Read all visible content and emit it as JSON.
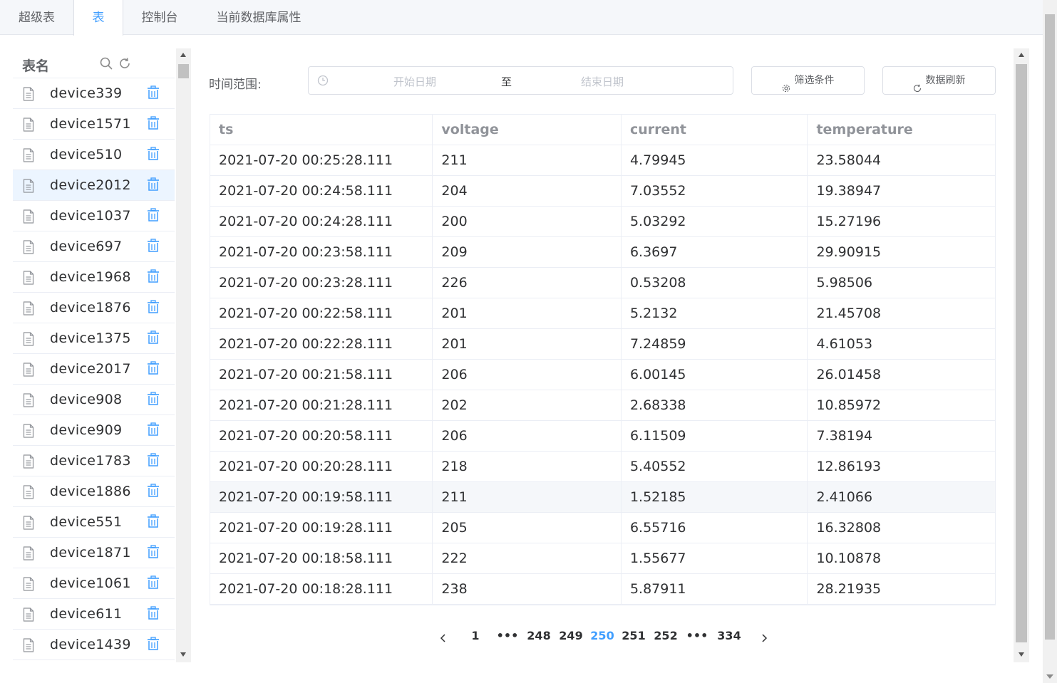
{
  "tabs": [
    {
      "label": "超级表"
    },
    {
      "label": "表"
    },
    {
      "label": "控制台"
    },
    {
      "label": "当前数据库属性"
    }
  ],
  "active_tab": "表",
  "accent_color": "#409eff",
  "sidebar": {
    "title": "表名",
    "search_icon": "search-icon",
    "refresh_icon": "refresh-icon",
    "selected_item": "device2012",
    "items": [
      {
        "label": "device339"
      },
      {
        "label": "device1571"
      },
      {
        "label": "device510"
      },
      {
        "label": "device2012"
      },
      {
        "label": "device1037"
      },
      {
        "label": "device697"
      },
      {
        "label": "device1968"
      },
      {
        "label": "device1876"
      },
      {
        "label": "device1375"
      },
      {
        "label": "device2017"
      },
      {
        "label": "device908"
      },
      {
        "label": "device909"
      },
      {
        "label": "device1783"
      },
      {
        "label": "device1886"
      },
      {
        "label": "device551"
      },
      {
        "label": "device1871"
      },
      {
        "label": "device1061"
      },
      {
        "label": "device611"
      },
      {
        "label": "device1439"
      }
    ]
  },
  "filter": {
    "time_range_label": "时间范围:",
    "start_placeholder": "开始日期",
    "separator": "至",
    "end_placeholder": "结束日期",
    "filter_button": "筛选条件",
    "refresh_button": "数据刷新"
  },
  "table": {
    "columns": [
      "ts",
      "voltage",
      "current",
      "temperature"
    ],
    "rows": [
      [
        "2021-07-20 00:25:28.111",
        "211",
        "4.79945",
        "23.58044"
      ],
      [
        "2021-07-20 00:24:58.111",
        "204",
        "7.03552",
        "19.38947"
      ],
      [
        "2021-07-20 00:24:28.111",
        "200",
        "5.03292",
        "15.27196"
      ],
      [
        "2021-07-20 00:23:58.111",
        "209",
        "6.3697",
        "29.90915"
      ],
      [
        "2021-07-20 00:23:28.111",
        "226",
        "0.53208",
        "5.98506"
      ],
      [
        "2021-07-20 00:22:58.111",
        "201",
        "5.2132",
        "21.45708"
      ],
      [
        "2021-07-20 00:22:28.111",
        "201",
        "7.24859",
        "4.61053"
      ],
      [
        "2021-07-20 00:21:58.111",
        "206",
        "6.00145",
        "26.01458"
      ],
      [
        "2021-07-20 00:21:28.111",
        "202",
        "2.68338",
        "10.85972"
      ],
      [
        "2021-07-20 00:20:58.111",
        "206",
        "6.11509",
        "7.38194"
      ],
      [
        "2021-07-20 00:20:28.111",
        "218",
        "5.40552",
        "12.86193"
      ],
      [
        "2021-07-20 00:19:58.111",
        "211",
        "1.52185",
        "2.41066"
      ],
      [
        "2021-07-20 00:19:28.111",
        "205",
        "6.55716",
        "16.32808"
      ],
      [
        "2021-07-20 00:18:58.111",
        "222",
        "1.55677",
        "10.10878"
      ],
      [
        "2021-07-20 00:18:28.111",
        "238",
        "5.87911",
        "28.21935"
      ]
    ],
    "hovered_row": 11
  },
  "pagination": {
    "pages": [
      "1",
      "•••",
      "248",
      "249",
      "250",
      "251",
      "252",
      "•••",
      "334"
    ],
    "current": "250"
  }
}
